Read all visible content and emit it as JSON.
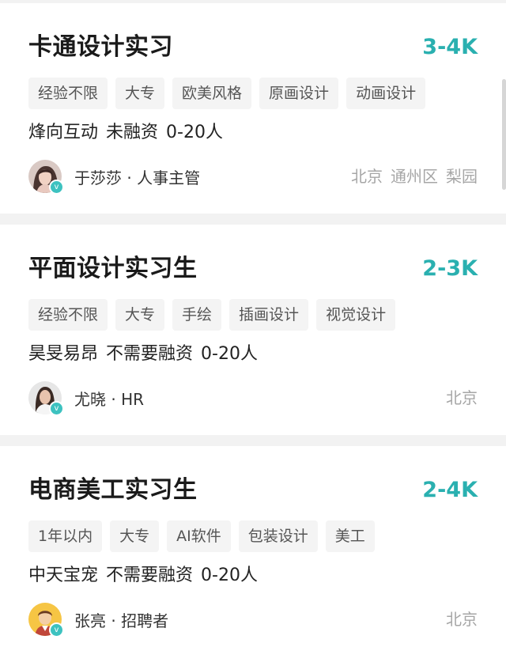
{
  "jobs": [
    {
      "title": "卡通设计实习",
      "salary": "3-4K",
      "tags": [
        "经验不限",
        "大专",
        "欧美风格",
        "原画设计",
        "动画设计"
      ],
      "company": "烽向互动",
      "funding": "未融资",
      "size": "0-20人",
      "recruiter": "于莎莎 · 人事主管",
      "location": [
        "北京",
        "通州区",
        "梨园"
      ]
    },
    {
      "title": "平面设计实习生",
      "salary": "2-3K",
      "tags": [
        "经验不限",
        "大专",
        "手绘",
        "插画设计",
        "视觉设计"
      ],
      "company": "昊旻易昂",
      "funding": "不需要融资",
      "size": "0-20人",
      "recruiter": "尤晓 · HR",
      "location": [
        "北京"
      ]
    },
    {
      "title": "电商美工实习生",
      "salary": "2-4K",
      "tags": [
        "1年以内",
        "大专",
        "AI软件",
        "包装设计",
        "美工"
      ],
      "company": "中天宝宠",
      "funding": "不需要融资",
      "size": "0-20人",
      "recruiter": "张亮 · 招聘者",
      "location": [
        "北京"
      ]
    }
  ],
  "verify_badge": "v",
  "colors": {
    "salary": "#2ab0b0",
    "tag_bg": "#f4f4f4",
    "location": "#a6a6a6",
    "verify": "#3dc2c0"
  },
  "icons": [
    "recruiter-avatar",
    "verified-badge-icon"
  ]
}
